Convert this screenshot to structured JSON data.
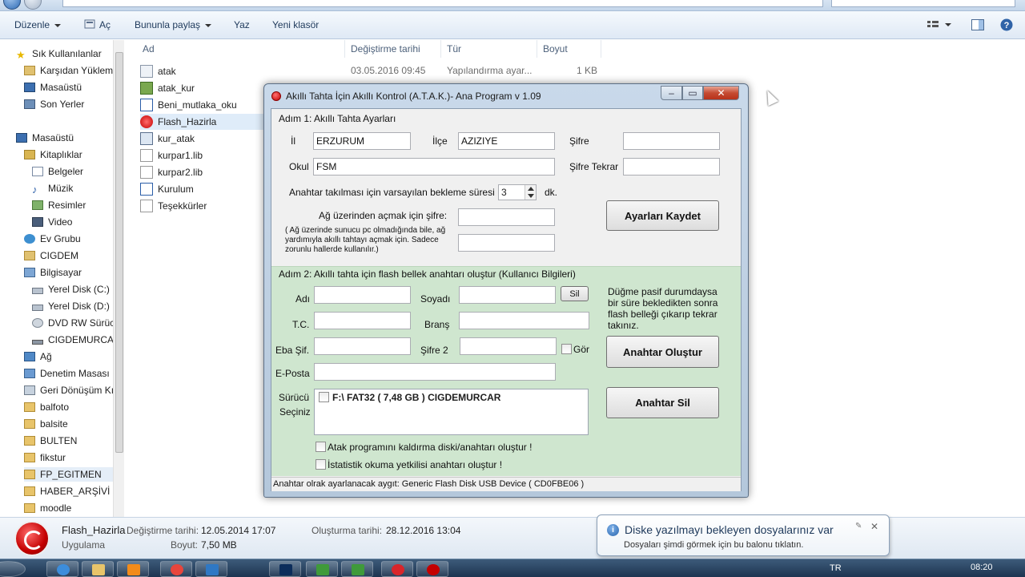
{
  "explorer": {
    "toolbar": {
      "organize": "Düzenle",
      "open": "Aç",
      "share": "Bununla paylaş",
      "print": "Yaz",
      "new_folder": "Yeni klasör"
    },
    "nav": [
      {
        "label": "Sık Kullanılanlar"
      },
      {
        "label": "Karşıdan Yüklem"
      },
      {
        "label": "Masaüstü"
      },
      {
        "label": "Son Yerler"
      },
      {
        "label": "Masaüstü"
      },
      {
        "label": "Kitaplıklar"
      },
      {
        "label": "Belgeler"
      },
      {
        "label": "Müzik"
      },
      {
        "label": "Resimler"
      },
      {
        "label": "Video"
      },
      {
        "label": "Ev Grubu"
      },
      {
        "label": "CIGDEM"
      },
      {
        "label": "Bilgisayar"
      },
      {
        "label": "Yerel Disk (C:)"
      },
      {
        "label": "Yerel Disk (D:)"
      },
      {
        "label": "DVD RW Sürücü"
      },
      {
        "label": "CIGDEMURCAR"
      },
      {
        "label": "Ağ"
      },
      {
        "label": "Denetim Masası"
      },
      {
        "label": "Geri Dönüşüm Kı"
      },
      {
        "label": "balfoto"
      },
      {
        "label": "balsite"
      },
      {
        "label": "BULTEN"
      },
      {
        "label": "fikstur"
      },
      {
        "label": "FP_EGITMEN"
      },
      {
        "label": "HABER_ARŞİVİ"
      },
      {
        "label": "moodle"
      }
    ],
    "columns": {
      "name": "Ad",
      "modified": "Değiştirme tarihi",
      "type": "Tür",
      "size": "Boyut"
    },
    "files": [
      {
        "name": "atak",
        "modified": "03.05.2016 09:45",
        "type": "Yapılandırma ayar...",
        "size": "1 KB"
      },
      {
        "name": "atak_kur"
      },
      {
        "name": "Beni_mutlaka_oku"
      },
      {
        "name": "Flash_Hazirla"
      },
      {
        "name": "kur_atak"
      },
      {
        "name": "kurpar1.lib"
      },
      {
        "name": "kurpar2.lib"
      },
      {
        "name": "Kurulum"
      },
      {
        "name": "Teşekkürler"
      }
    ],
    "details": {
      "name": "Flash_Hazirla",
      "kind": "Uygulama",
      "modified_label": "Değiştirme tarihi:",
      "modified_value": "12.05.2014 17:07",
      "size_label": "Boyut:",
      "size_value": "7,50 MB",
      "created_label": "Oluşturma tarihi:",
      "created_value": "28.12.2016 13:04"
    }
  },
  "dialog": {
    "title": "Akıllı Tahta İçin Akıllı Kontrol (A.T.A.K.)- Ana Program v 1.09",
    "section1": {
      "title": "Adım 1: Akıllı Tahta Ayarları",
      "il_label": "İl",
      "il_value": "ERZURUM",
      "ilce_label": "İlçe",
      "ilce_value": "AZIZIYE",
      "sifre_label": "Şifre",
      "sifre_value": "",
      "okul_label": "Okul",
      "okul_value": "FSM",
      "sifre_tekrar_label": "Şifre Tekrar",
      "sifre_tekrar_value": "",
      "wait_label": "Anahtar takılması için varsayılan bekleme süresi",
      "wait_value": "3",
      "wait_unit": "dk.",
      "network_label": "Ağ üzerinden açmak için şifre:",
      "network_value": "",
      "network_value2": "",
      "network_note": "( Ağ üzerinde sunucu pc olmadığında bile, ağ yardımıyla akıllı tahtayı açmak için. Sadece zorunlu hallerde kullanılır.)",
      "save_button": "Ayarları Kaydet"
    },
    "section2": {
      "title": "Adım 2: Akıllı tahta için flash bellek anahtarı oluştur (Kullanıcı Bilgileri)",
      "adi_label": "Adı",
      "adi_value": "",
      "soyadi_label": "Soyadı",
      "soyadi_value": "",
      "sil_button": "Sil",
      "tc_label": "T.C.",
      "tc_value": "",
      "brans_label": "Branş",
      "brans_value": "",
      "eba_label": "Eba Şif.",
      "eba_value": "",
      "sifre2_label": "Şifre 2",
      "sifre2_value": "",
      "gor_label": "Gör",
      "eposta_label": "E-Posta",
      "eposta_value": "",
      "surucu_label_1": "Sürücü",
      "surucu_label_2": "Seçiniz",
      "drive_item": "F:\\ FAT32 ( 7,48 GB ) CIGDEMURCAR",
      "hint": "Düğme pasif durumdaysa bir süre bekledikten sonra flash belleği çıkarıp tekrar takınız.",
      "create_key_button": "Anahtar Oluştur",
      "delete_key_button": "Anahtar Sil",
      "uninstall_check": "Atak programını kaldırma diski/anahtarı oluştur !",
      "stats_check": "İstatistik okuma yetkilisi anahtarı oluştur !"
    },
    "status": "Anahtar olrak ayarlanacak aygıt: Generic Flash Disk USB Device ( CD0FBE06 )"
  },
  "balloon": {
    "title": "Diske yazılmayı bekleyen dosyalarınız var",
    "body": "Dosyaları şimdi görmek için bu balonu tıklatın."
  },
  "taskbar": {
    "lang": "TR",
    "clock": "08:20"
  },
  "colors": {
    "section2_bg": "#cfe6cf",
    "close_button": "#c54b32",
    "taskbar": "#1d3450"
  }
}
